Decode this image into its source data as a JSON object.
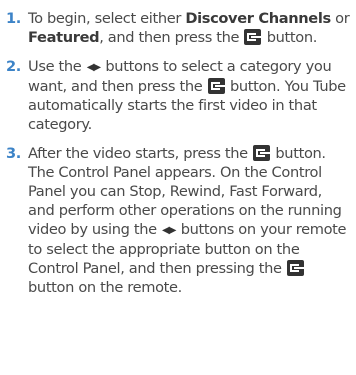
{
  "steps": [
    {
      "num": "1.",
      "p1": "To begin, select either ",
      "b1": "Discover Channels",
      "p2": " or ",
      "b2": "Featured",
      "p3": ", and then press the ",
      "p4": " button."
    },
    {
      "num": "2.",
      "p1": "Use the ",
      "p2": " buttons to select a category you want, and then press the ",
      "p3": " button. You Tube automatically starts the first video in that category."
    },
    {
      "num": "3.",
      "p1": "After the video starts, press the ",
      "p2": " button. The Control Panel appears. On the Control Panel you can Stop, Rewind, Fast Forward, and perform other operations on the running video by using the ",
      "p3": " buttons on your remote to select the appropriate button on the Control Panel, and then pressing the ",
      "p4": " button on the remote."
    }
  ],
  "icons": {
    "lr_glyph": "◀▶",
    "enter": "enter-icon"
  }
}
